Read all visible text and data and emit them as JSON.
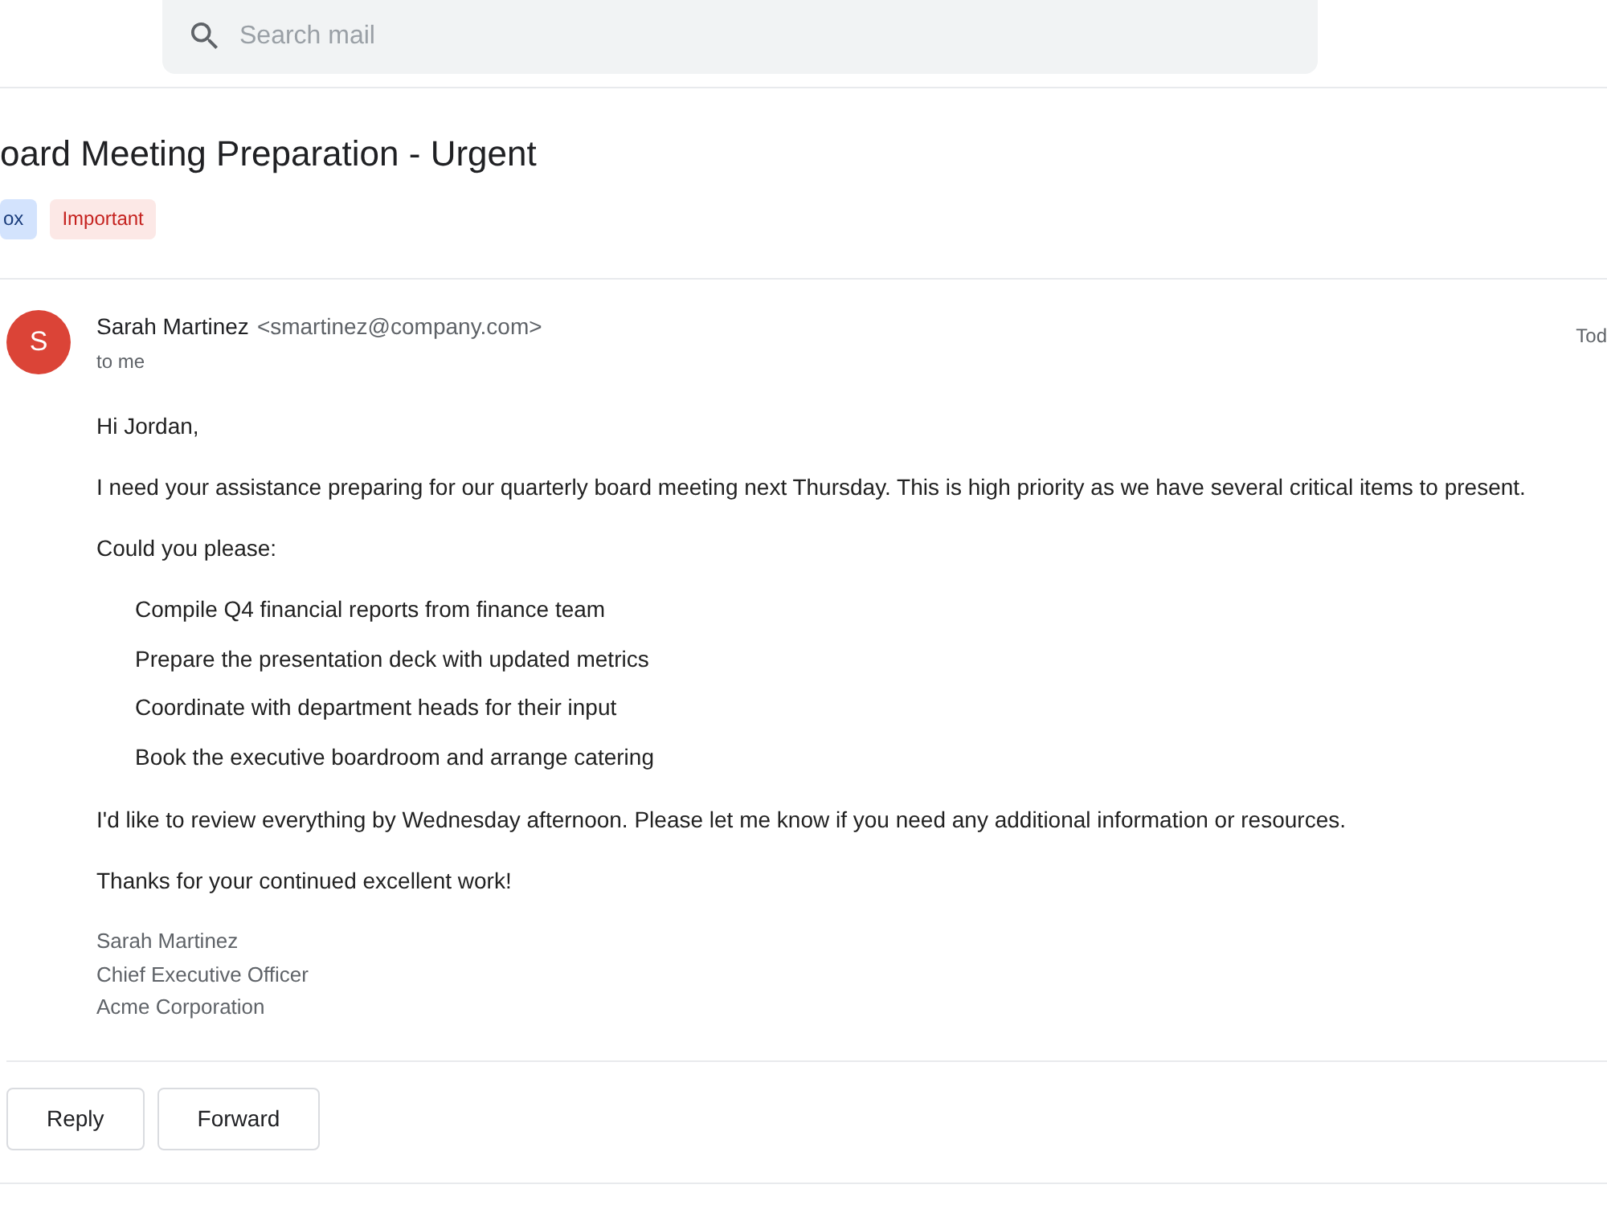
{
  "search": {
    "placeholder": "Search mail"
  },
  "subject": "oard Meeting Preparation - Urgent",
  "labels": [
    {
      "text": "ox",
      "kind": "folder",
      "color": "#d3e3fd"
    },
    {
      "text": "Important",
      "kind": "priority",
      "color": "#fce8e6"
    }
  ],
  "message": {
    "sender": {
      "initial": "S",
      "name": "Sarah Martinez",
      "email": "<smartinez@company.com>",
      "color": "#db4437"
    },
    "recipient": "to me",
    "date": "Tod",
    "body": [
      {
        "kind": "paragraph",
        "text": "Hi Jordan,"
      },
      {
        "kind": "paragraph",
        "text": "I need your assistance preparing for our quarterly board meeting next Thursday. This is high priority as we have several critical items to present."
      },
      {
        "kind": "paragraph",
        "text": "Could you please:"
      },
      {
        "kind": "list",
        "items": [
          "Compile Q4 financial reports from finance team",
          "Prepare the presentation deck with updated metrics",
          "Coordinate with department heads for their input",
          "Book the executive boardroom and arrange catering"
        ]
      },
      {
        "kind": "paragraph",
        "text": "I'd like to review everything by Wednesday afternoon. Please let me know if you need any additional information or resources."
      },
      {
        "kind": "paragraph",
        "text": "Thanks for your continued excellent work!"
      }
    ],
    "signature": [
      "Sarah Martinez",
      "Chief Executive Officer",
      "Acme Corporation"
    ]
  },
  "actions": [
    "Reply",
    "Forward"
  ]
}
